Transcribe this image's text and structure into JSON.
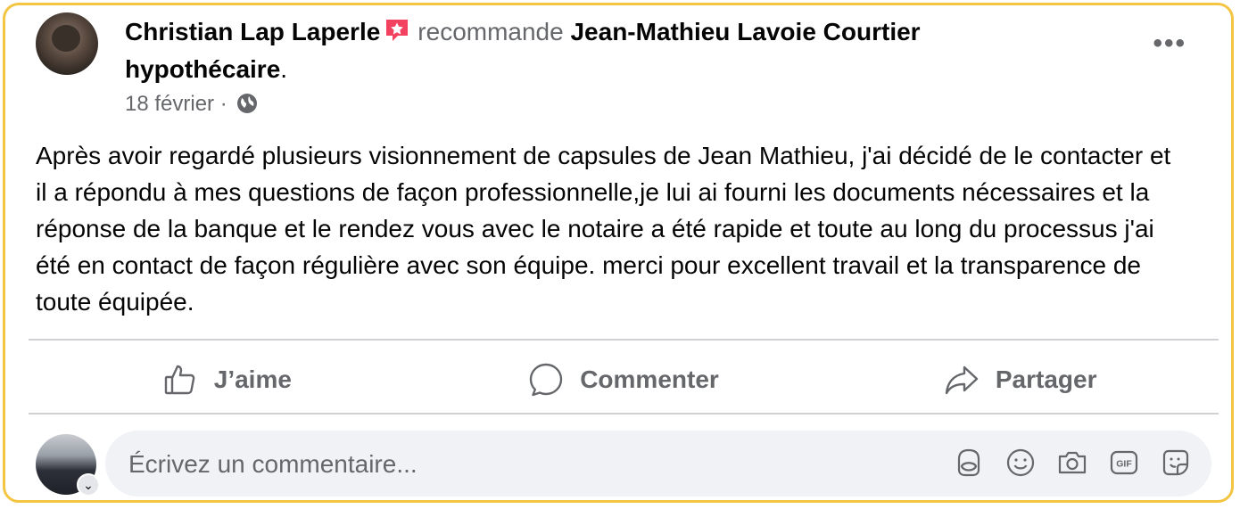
{
  "post": {
    "author": "Christian Lap Laperle",
    "verb": "recommande",
    "target_line1": "Jean-Mathieu Lavoie Courtier",
    "target_line2": "hypothécaire",
    "period": ".",
    "date": "18 février",
    "separator": "·",
    "audience_icon": "globe-icon",
    "more_icon": "more-options-icon",
    "more_label": "•••",
    "body": "Après avoir regardé plusieurs visionnement de capsules de Jean Mathieu, j'ai décidé de le contacter et il a répondu à mes questions de façon professionnelle,je lui ai fourni les documents nécessaires et la réponse de la banque et le rendez vous avec le notaire a été rapide et toute au long du processus j'ai été en contact de façon régulière avec son équipe. merci pour excellent travail et la transparence de toute équipée."
  },
  "actions": {
    "like": "J’aime",
    "comment": "Commenter",
    "share": "Partager"
  },
  "composer": {
    "placeholder": "Écrivez un commentaire...",
    "tools": [
      "avatar-sticker-icon",
      "emoji-icon",
      "camera-icon",
      "gif-icon",
      "sticker-icon"
    ]
  },
  "colors": {
    "border": "#f4c542",
    "recommend_badge": "#f3425f",
    "muted": "#65676b"
  }
}
